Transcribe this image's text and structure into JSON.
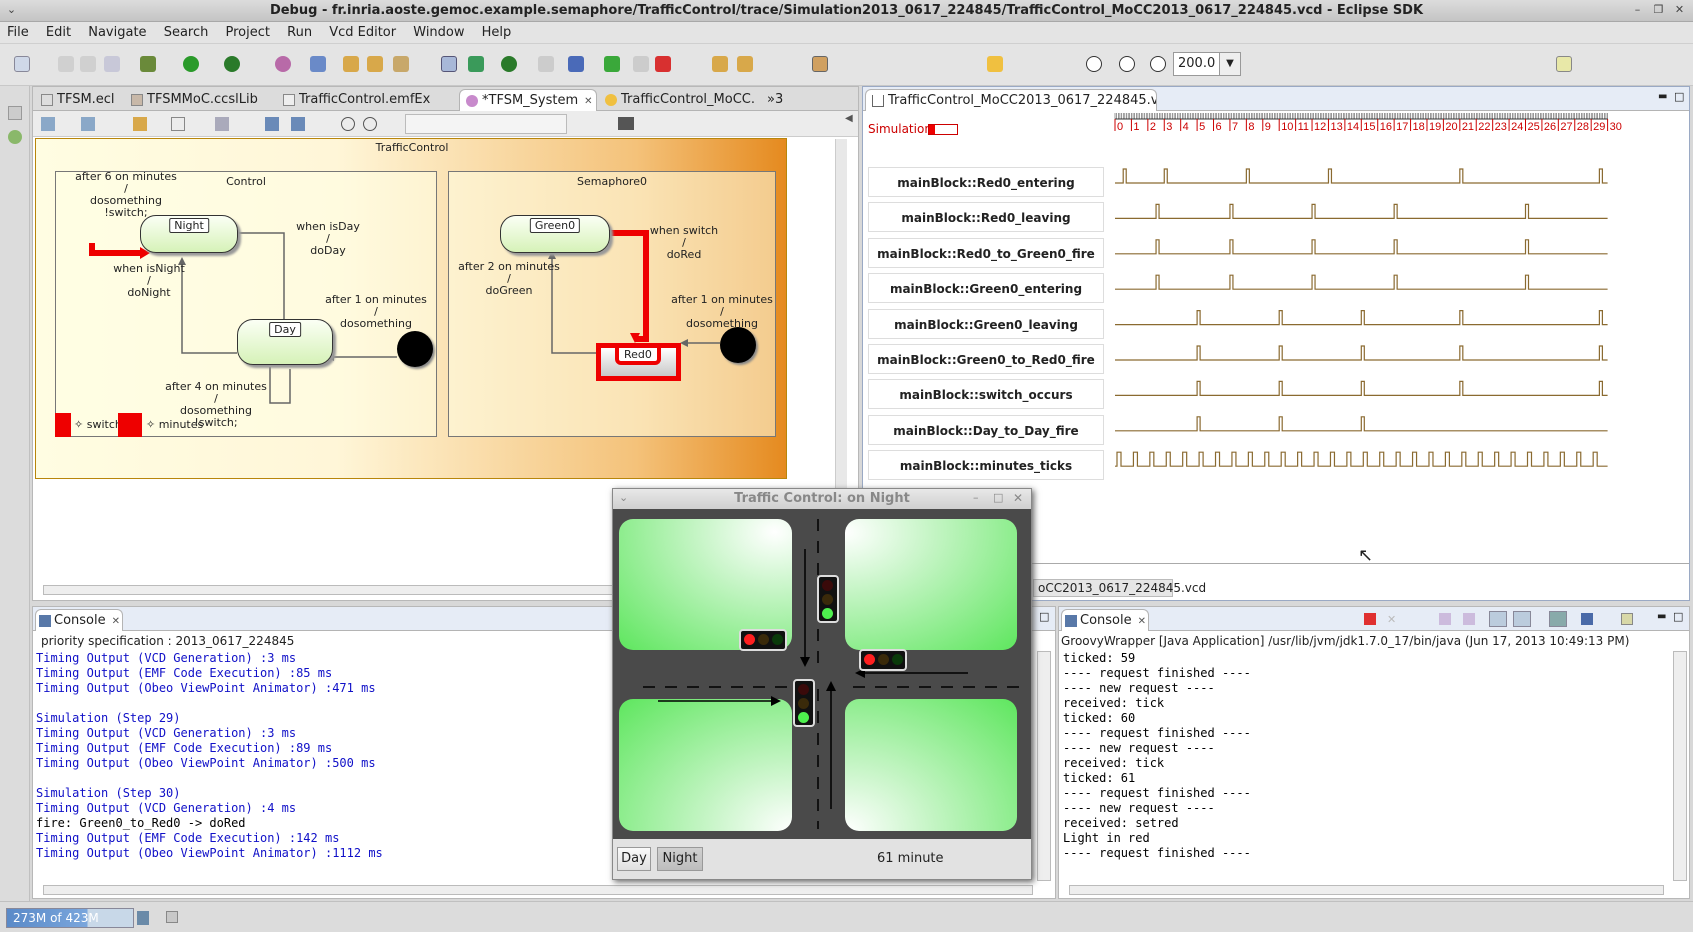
{
  "window": {
    "title": "Debug - fr.inria.aoste.gemoc.example.semaphore/TrafficControl/trace/Simulation2013_0617_224845/TrafficControl_MoCC2013_0617_224845.vcd - Eclipse SDK"
  },
  "menu": [
    "File",
    "Edit",
    "Navigate",
    "Search",
    "Project",
    "Run",
    "Vcd Editor",
    "Window",
    "Help"
  ],
  "toolbar": {
    "zoom_value": "200.0"
  },
  "editor_tabs": [
    {
      "label": "TFSM.ecl"
    },
    {
      "label": "TFSMMoC.ccslLib"
    },
    {
      "label": "TrafficControl.emfEx"
    },
    {
      "label": "*TFSM_System"
    },
    {
      "label": "TrafficControl_MoCC."
    },
    {
      "label": "»3"
    }
  ],
  "diagram": {
    "title": "TrafficControl",
    "control": {
      "title": "Control",
      "night_state": "Night",
      "day_state": "Day",
      "t_after6": [
        "after 6  on minutes",
        "/",
        "dosomething",
        "!switch;"
      ],
      "t_isday": [
        "when isDay",
        "/",
        "doDay"
      ],
      "t_isnight": [
        "when isNight",
        "/",
        "doNight"
      ],
      "t_after1": [
        "after 1  on minutes",
        "/",
        "dosomething"
      ],
      "t_after4": [
        "after 4  on minutes",
        "/",
        "dosomething",
        "!switch;"
      ]
    },
    "semaphore": {
      "title": "Semaphore0",
      "green_state": "Green0",
      "red_state": "Red0",
      "t_switch": [
        "when switch",
        "/",
        "doRed"
      ],
      "t_after2": [
        "after 2  on minutes",
        "/",
        "doGreen"
      ],
      "t_after1": [
        "after 1  on minutes",
        "/",
        "dosomething"
      ]
    },
    "legend": {
      "switch": "switch",
      "minutes": "minutes"
    }
  },
  "vcd": {
    "tab": "TrafficControl_MoCC2013_0617_224845.vcd",
    "sim_label": "Simulation",
    "ticks": [
      "0",
      "1",
      "2",
      "3",
      "4",
      "5",
      "6",
      "7",
      "8",
      "9",
      "10",
      "11",
      "12",
      "13",
      "14",
      "15",
      "16",
      "17",
      "18",
      "19",
      "20",
      "21",
      "22",
      "23",
      "24",
      "25",
      "26",
      "27",
      "28",
      "29",
      "30"
    ],
    "signals": [
      {
        "name": "mainBlock::Red0_entering",
        "pulses": [
          0.5,
          3,
          8,
          13,
          21,
          29.5
        ]
      },
      {
        "name": "mainBlock::Red0_leaving",
        "pulses": [
          2.5,
          7,
          12,
          17,
          25
        ]
      },
      {
        "name": "mainBlock::Red0_to_Green0_fire",
        "pulses": [
          2.5,
          7,
          12,
          17,
          25
        ]
      },
      {
        "name": "mainBlock::Green0_entering",
        "pulses": [
          2.5,
          7,
          12,
          17,
          25
        ]
      },
      {
        "name": "mainBlock::Green0_leaving",
        "pulses": [
          5,
          10,
          15,
          21,
          29.5
        ]
      },
      {
        "name": "mainBlock::Green0_to_Red0_fire",
        "pulses": [
          5,
          10,
          15,
          21,
          29.5
        ]
      },
      {
        "name": "mainBlock::switch_occurs",
        "pulses": [
          5,
          10,
          15,
          21,
          29.5
        ]
      },
      {
        "name": "mainBlock::Day_to_Day_fire",
        "pulses": [
          5,
          10,
          15
        ]
      },
      {
        "name": "mainBlock::minutes_ticks",
        "pulses": []
      }
    ],
    "bottom_tab": "oCC2013_0617_224845.vcd"
  },
  "console_left": {
    "title": "Console",
    "header": "priority specification :  2013_0617_224845",
    "lines": [
      {
        "t": "Timing Output (VCD Generation) :3 ms",
        "c": "blue"
      },
      {
        "t": "Timing Output (EMF Code Execution) :85 ms",
        "c": "blue"
      },
      {
        "t": "Timing Output (Obeo ViewPoint Animator) :471 ms",
        "c": "blue"
      },
      {
        "t": "",
        "c": "blue"
      },
      {
        "t": "Simulation (Step 29)",
        "c": "blue"
      },
      {
        "t": "Timing Output (VCD Generation) :3 ms",
        "c": "blue"
      },
      {
        "t": "Timing Output (EMF Code Execution) :89 ms",
        "c": "blue"
      },
      {
        "t": "Timing Output (Obeo ViewPoint Animator) :500 ms",
        "c": "blue"
      },
      {
        "t": "",
        "c": "blue"
      },
      {
        "t": "Simulation (Step 30)",
        "c": "blue"
      },
      {
        "t": "Timing Output (VCD Generation) :4 ms",
        "c": "blue"
      },
      {
        "t": "fire: Green0_to_Red0 -> doRed",
        "c": "black"
      },
      {
        "t": "Timing Output (EMF Code Execution) :142 ms",
        "c": "blue"
      },
      {
        "t": "Timing Output (Obeo ViewPoint Animator) :1112 ms",
        "c": "blue"
      }
    ]
  },
  "console_right": {
    "title": "Console",
    "header": "GroovyWrapper [Java Application] /usr/lib/jvm/jdk1.7.0_17/bin/java (Jun 17, 2013 10:49:13 PM)",
    "lines": [
      "ticked: 59",
      "---- request finished ----",
      "---- new request ----",
      "received: tick",
      "ticked: 60",
      "---- request finished ----",
      "---- new request ----",
      "received: tick",
      "ticked: 61",
      "---- request finished ----",
      "---- new request ----",
      "received: setred",
      "Light in red",
      "---- request finished ----"
    ]
  },
  "traffic": {
    "title": "Traffic Control: on Night",
    "day_button": "Day",
    "night_button": "Night",
    "status": "61 minute"
  },
  "statusbar": {
    "memory": "273M of 423M"
  }
}
